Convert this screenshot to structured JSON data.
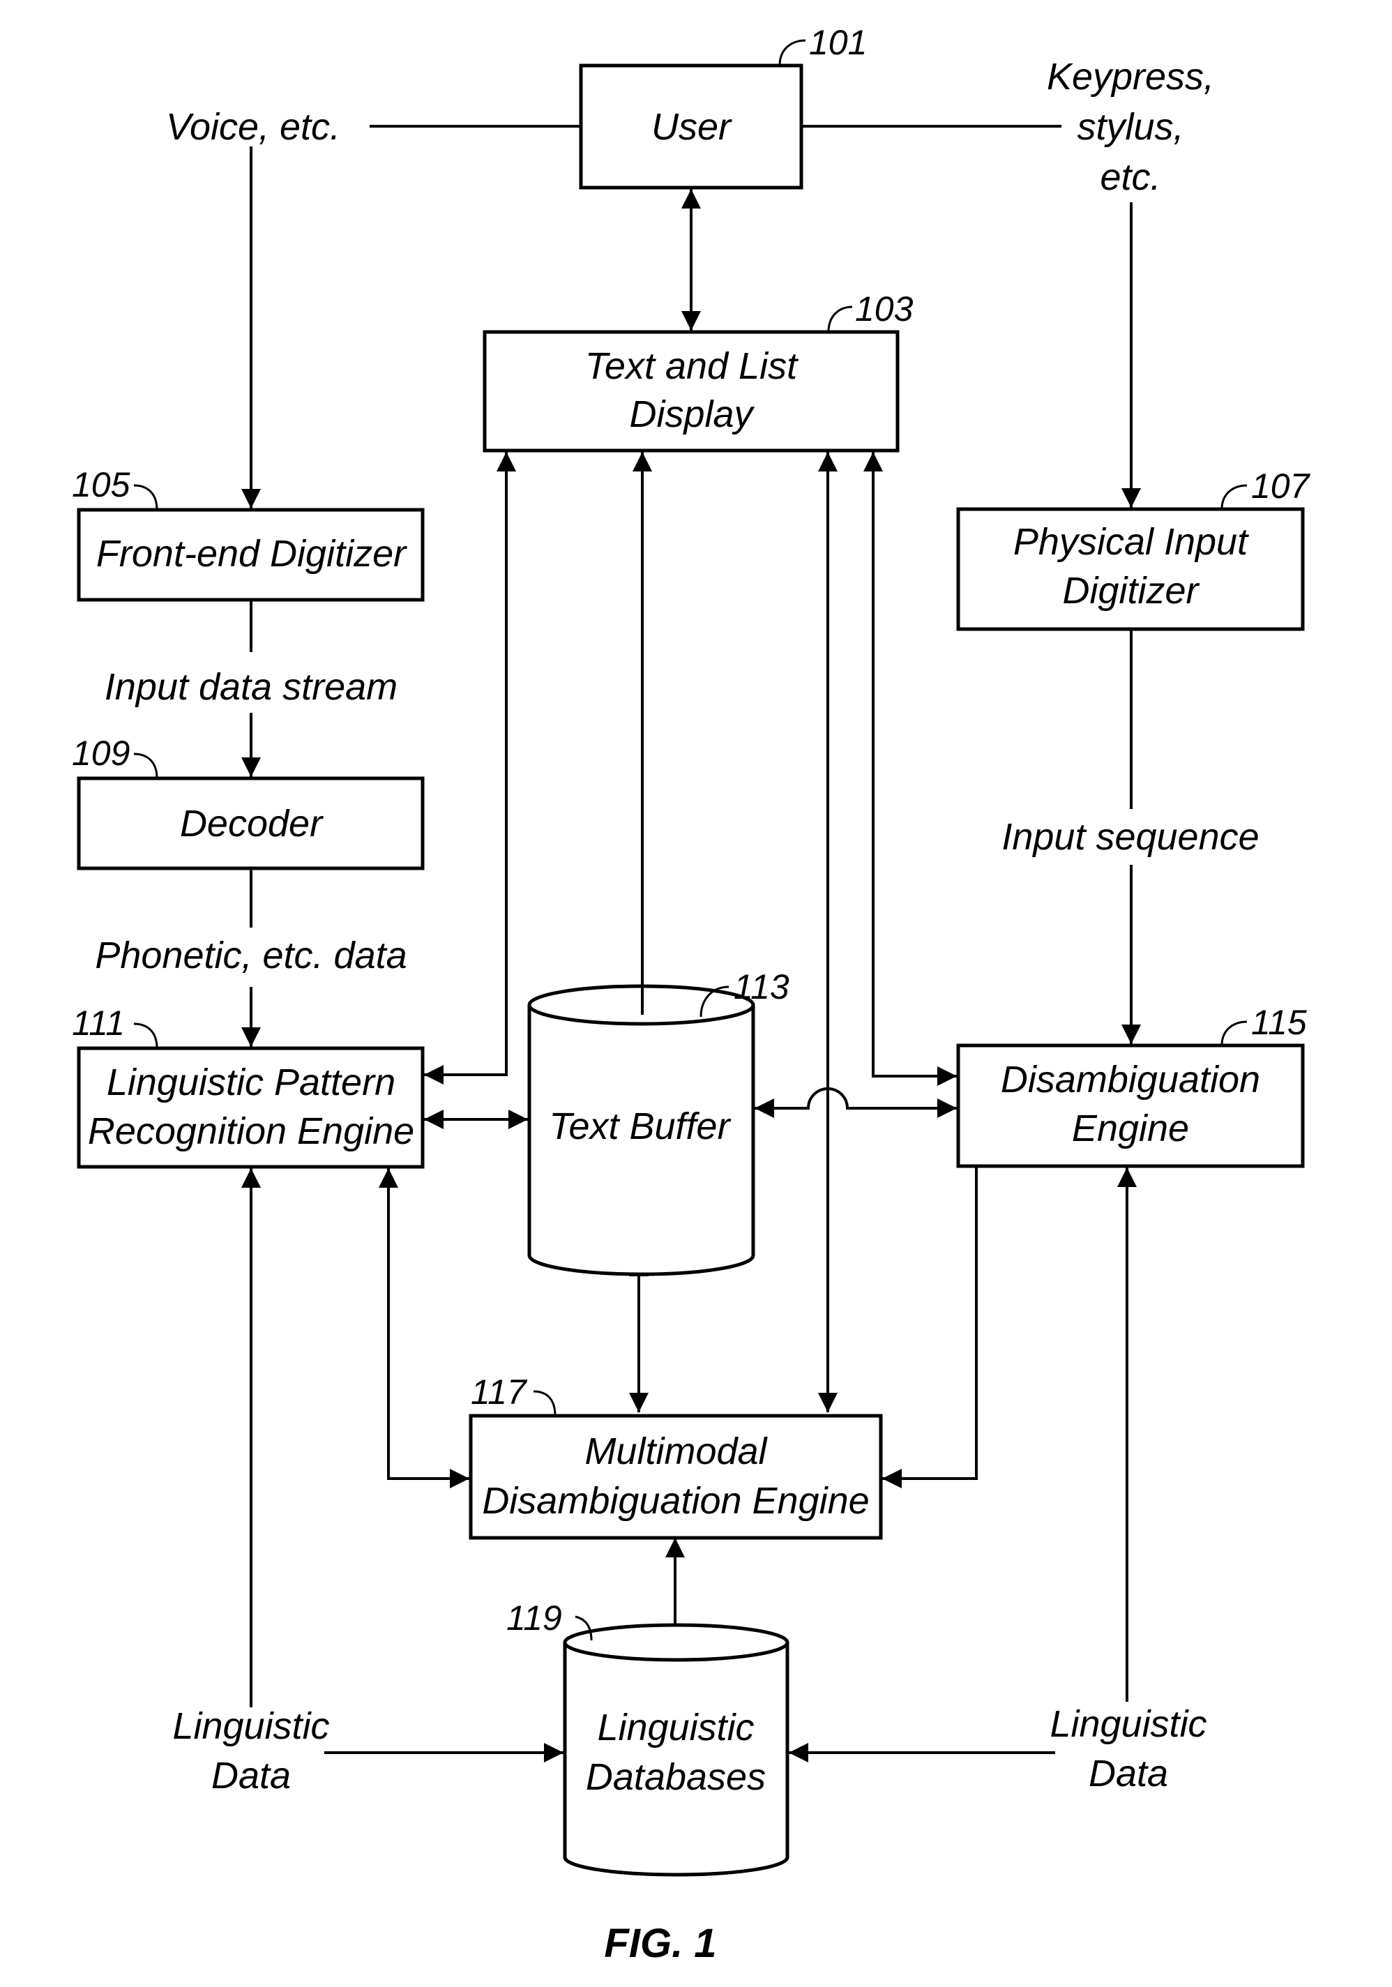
{
  "figure": {
    "caption": "FIG. 1",
    "nodes": [
      {
        "id": "user",
        "ref": "101",
        "shape": "box",
        "lines": [
          "User"
        ]
      },
      {
        "id": "text_list_display",
        "ref": "103",
        "shape": "box",
        "lines": [
          "Text and List",
          "Display"
        ]
      },
      {
        "id": "front_end_digitizer",
        "ref": "105",
        "shape": "box",
        "lines": [
          "Front-end Digitizer"
        ]
      },
      {
        "id": "physical_input_digitizer",
        "ref": "107",
        "shape": "box",
        "lines": [
          "Physical Input",
          "Digitizer"
        ]
      },
      {
        "id": "decoder",
        "ref": "109",
        "shape": "box",
        "lines": [
          "Decoder"
        ]
      },
      {
        "id": "linguistic_pattern_recognition_engine",
        "ref": "111",
        "shape": "box",
        "lines": [
          "Linguistic Pattern",
          "Recognition Engine"
        ]
      },
      {
        "id": "text_buffer",
        "ref": "113",
        "shape": "cylinder",
        "lines": [
          "Text Buffer"
        ]
      },
      {
        "id": "disambiguation_engine",
        "ref": "115",
        "shape": "box",
        "lines": [
          "Disambiguation",
          "Engine"
        ]
      },
      {
        "id": "multimodal_disambiguation_engine",
        "ref": "117",
        "shape": "box",
        "lines": [
          "Multimodal",
          "Disambiguation Engine"
        ]
      },
      {
        "id": "linguistic_databases",
        "ref": "119",
        "shape": "cylinder",
        "lines": [
          "Linguistic",
          "Databases"
        ]
      }
    ],
    "free_labels": {
      "voice": [
        "Voice, etc."
      ],
      "keypress": [
        "Keypress,",
        "stylus,",
        "etc."
      ],
      "input_data_stream": [
        "Input data stream"
      ],
      "phonetic_data": [
        "Phonetic, etc. data"
      ],
      "input_sequence": [
        "Input sequence"
      ],
      "linguistic_data_left": [
        "Linguistic",
        "Data"
      ],
      "linguistic_data_right": [
        "Linguistic",
        "Data"
      ]
    },
    "edges": [
      {
        "from": "user",
        "to": "voice",
        "type": "line"
      },
      {
        "from": "user",
        "to": "keypress",
        "type": "line"
      },
      {
        "from": "user",
        "to": "text_list_display",
        "type": "bidirectional"
      },
      {
        "from": "voice",
        "to": "front_end_digitizer",
        "type": "arrow"
      },
      {
        "from": "front_end_digitizer",
        "to": "decoder",
        "type": "arrow",
        "label": "Input data stream"
      },
      {
        "from": "decoder",
        "to": "linguistic_pattern_recognition_engine",
        "type": "arrow",
        "label": "Phonetic, etc. data"
      },
      {
        "from": "keypress",
        "to": "physical_input_digitizer",
        "type": "arrow"
      },
      {
        "from": "physical_input_digitizer",
        "to": "disambiguation_engine",
        "type": "arrow",
        "label": "Input sequence"
      },
      {
        "from": "text_list_display",
        "to": "linguistic_pattern_recognition_engine",
        "type": "bidirectional"
      },
      {
        "from": "text_buffer",
        "to": "text_list_display",
        "type": "arrow"
      },
      {
        "from": "multimodal_disambiguation_engine",
        "to": "text_list_display",
        "type": "bidirectional"
      },
      {
        "from": "text_list_display",
        "to": "disambiguation_engine",
        "type": "bidirectional"
      },
      {
        "from": "linguistic_pattern_recognition_engine",
        "to": "text_buffer",
        "type": "bidirectional"
      },
      {
        "from": "disambiguation_engine",
        "to": "text_buffer",
        "type": "bidirectional"
      },
      {
        "from": "text_buffer",
        "to": "multimodal_disambiguation_engine",
        "type": "bidirectional"
      },
      {
        "from": "linguistic_pattern_recognition_engine",
        "to": "multimodal_disambiguation_engine",
        "type": "bidirectional"
      },
      {
        "from": "disambiguation_engine",
        "to": "multimodal_disambiguation_engine",
        "type": "arrow"
      },
      {
        "from": "multimodal_disambiguation_engine",
        "to": "linguistic_databases",
        "type": "bidirectional"
      },
      {
        "from": "linguistic_data_left",
        "to": "linguistic_pattern_recognition_engine",
        "type": "arrow"
      },
      {
        "from": "linguistic_data_left",
        "to": "linguistic_databases",
        "type": "arrow"
      },
      {
        "from": "linguistic_data_right",
        "to": "disambiguation_engine",
        "type": "arrow"
      },
      {
        "from": "linguistic_data_right",
        "to": "linguistic_databases",
        "type": "arrow"
      }
    ]
  }
}
